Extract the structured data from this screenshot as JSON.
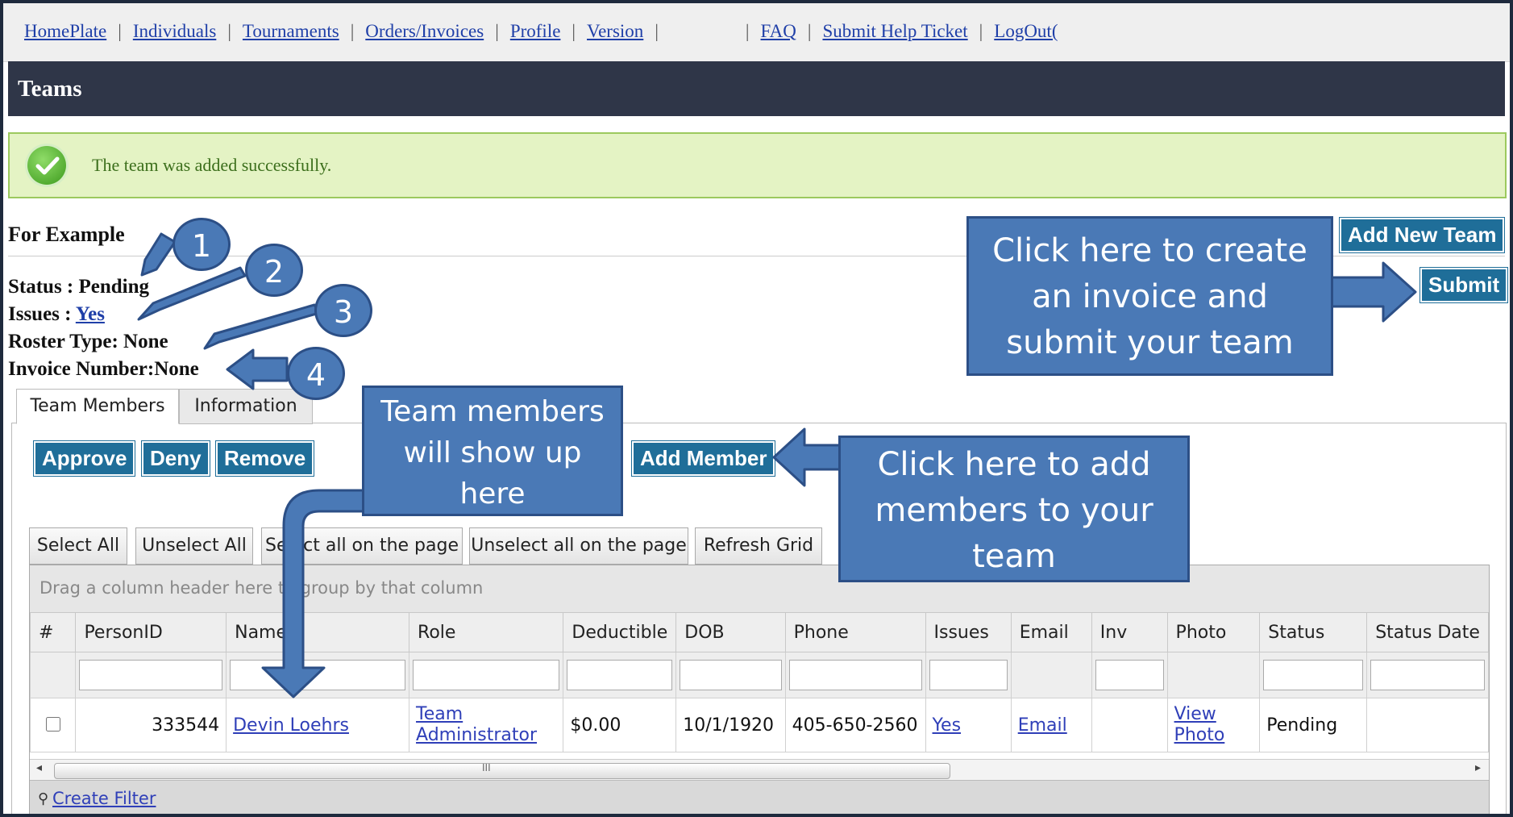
{
  "nav": {
    "links": [
      "HomePlate",
      "Individuals",
      "Tournaments",
      "Orders/Invoices",
      "Profile",
      "Version",
      "FAQ",
      "Submit Help Ticket",
      "LogOut("
    ]
  },
  "page_title": "Teams",
  "success_message": "The team was added successfully.",
  "team": {
    "name": "For Example",
    "status_label": "Status : Pending",
    "issues_label": "Issues : ",
    "issues_value": "Yes",
    "roster_label": "Roster Type: None",
    "invoice_label": "Invoice Number:None"
  },
  "buttons": {
    "add_new_team": "Add New Team",
    "submit": "Submit",
    "approve": "Approve",
    "deny": "Deny",
    "remove": "Remove",
    "add_member": "Add Member"
  },
  "tabs": [
    "Team Members",
    "Information"
  ],
  "grid_buttons": [
    "Select All",
    "Unselect All",
    "Select all on the page",
    "Unselect all on the page",
    "Refresh Grid"
  ],
  "grid": {
    "group_hint": "Drag a column header here to group by that column",
    "columns": [
      "#",
      "PersonID",
      "Name",
      "Role",
      "Deductible",
      "DOB",
      "Phone",
      "Issues",
      "Email",
      "Inv",
      "Photo",
      "Status",
      "Status Date"
    ],
    "row": {
      "person_id": "333544",
      "name": "Devin Loehrs",
      "role_line1": "Team",
      "role_line2": "Administrator",
      "deductible": "$0.00",
      "dob": "10/1/1920",
      "phone": "405-650-2560",
      "issues": "Yes",
      "email": "Email",
      "photo_line1": "View",
      "photo_line2": "Photo",
      "status": "Pending"
    },
    "scroll_mark": "III",
    "create_filter": "Create Filter"
  },
  "callouts": {
    "n1": "1",
    "n2": "2",
    "n3": "3",
    "n4": "4",
    "submit_hint": [
      "Click here to create",
      "an invoice and",
      "submit your team"
    ],
    "members_hint": [
      "Team members",
      "will show up",
      "here"
    ],
    "add_hint": [
      "Click here to add",
      "members to your",
      "team"
    ]
  },
  "colors": {
    "callout_fill": "#4a79b6",
    "title_bar": "#2f3648",
    "button_blue": "#1f6e99"
  }
}
